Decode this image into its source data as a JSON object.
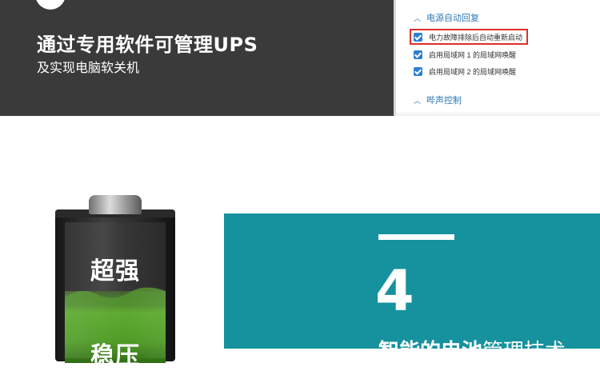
{
  "header": {
    "headline": "通过专用软件可管理UPS",
    "subline": "及实现电脑软关机"
  },
  "settings_panel": {
    "section_power": "电源自动回复",
    "options": [
      "电力故障排除后自动重新启动",
      "启用局域网 1 的局域网唤醒",
      "启用局域网 2 的局域网唤醒"
    ],
    "section_buzzer": "哔声控制"
  },
  "battery": {
    "label_top": "超强",
    "label_bottom": "稳压"
  },
  "feature": {
    "number": "4",
    "title_bold": "智能的电池",
    "title_thin": "管理技术"
  },
  "colors": {
    "dark_band": "#3a3a3a",
    "teal": "#16929e",
    "link_blue": "#2e79b8",
    "highlight_red": "#d9302c"
  }
}
